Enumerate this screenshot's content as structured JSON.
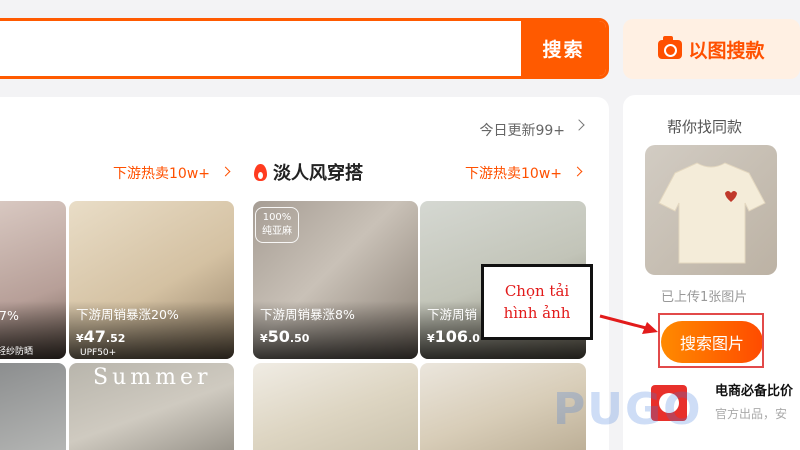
{
  "search": {
    "button_label": "搜索"
  },
  "image_search": {
    "label": "以图搜款",
    "icon": "camera-icon"
  },
  "feed": {
    "update_text": "今日更新99+",
    "left_hot_label": "下游热卖10w+",
    "section_title": "淡人风穿搭",
    "right_hot_label": "下游热卖10w+",
    "products": [
      {
        "sales": "7%",
        "price_int": "",
        "price_dec": "",
        "sub": "轻纱防晒"
      },
      {
        "sales": "下游周销暴涨20%",
        "price_int": "47",
        "price_dec": ".52",
        "sub": "UPF50+"
      },
      {
        "sales": "下游周销暴涨8%",
        "price_int": "50",
        "price_dec": ".50",
        "badge_top": "100%",
        "badge_bottom": "纯亚麻"
      },
      {
        "sales": "下游周销",
        "price_int": "106",
        "price_dec": ".0"
      },
      {
        "overlay_text": "Summer"
      }
    ]
  },
  "sidebar": {
    "title": "帮你找同款",
    "uploaded_text": "已上传1张图片",
    "search_button": "搜索图片",
    "ecom_title": "电商必备比价",
    "ecom_sub": "官方出品，安"
  },
  "annotation": {
    "line1": "Chọn tải",
    "line2": "hình ảnh",
    "accent": "#e21b1b"
  },
  "watermark": "PUGO",
  "colors": {
    "brand": "#ff5a00",
    "accent": "#ff5000"
  }
}
